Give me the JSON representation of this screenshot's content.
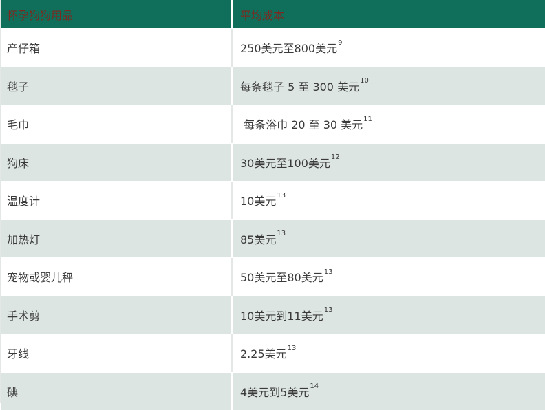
{
  "table": {
    "headers": [
      "怀孕狗狗用品",
      "平均成本"
    ],
    "rows": [
      {
        "item": "产仔箱",
        "cost": "250美元至800美元",
        "note": "9"
      },
      {
        "item": "毯子",
        "cost": "每条毯子 5 至 300 美元",
        "note": "10"
      },
      {
        "item": "毛巾",
        "cost": " 每条浴巾 20 至 30 美元",
        "note": "11"
      },
      {
        "item": "狗床",
        "cost": "30美元至100美元",
        "note": "12"
      },
      {
        "item": "温度计",
        "cost": "10美元",
        "note": "13"
      },
      {
        "item": "加热灯",
        "cost": "85美元",
        "note": "13"
      },
      {
        "item": "宠物或婴儿秤",
        "cost": "50美元至80美元",
        "note": "13"
      },
      {
        "item": "手术剪",
        "cost": "10美元到11美元",
        "note": "13"
      },
      {
        "item": "牙线",
        "cost": "2.25美元",
        "note": "13"
      },
      {
        "item": "碘",
        "cost": "4美元到5美元",
        "note": "14"
      }
    ]
  }
}
